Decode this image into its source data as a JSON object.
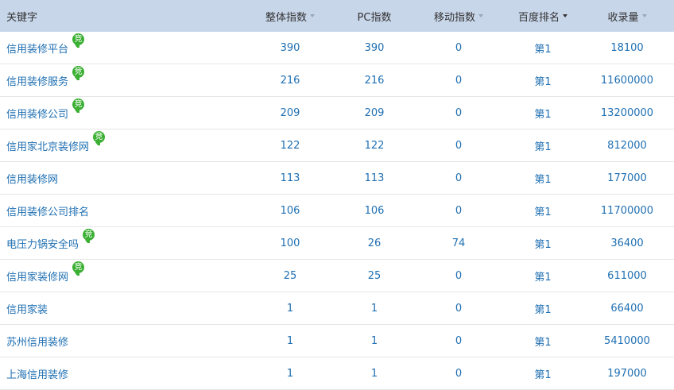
{
  "header": {
    "keyword": "关键字",
    "overall": "整体指数",
    "pc": "PC指数",
    "mobile": "移动指数",
    "rank": "百度排名",
    "indexed": "收录量"
  },
  "badge_text": "竞",
  "rows": [
    {
      "keyword": "信用装修平台",
      "overall": "390",
      "pc": "390",
      "mobile": "0",
      "rank": "第1",
      "indexed": "18100",
      "badge": true
    },
    {
      "keyword": "信用装修服务",
      "overall": "216",
      "pc": "216",
      "mobile": "0",
      "rank": "第1",
      "indexed": "11600000",
      "badge": true
    },
    {
      "keyword": "信用装修公司",
      "overall": "209",
      "pc": "209",
      "mobile": "0",
      "rank": "第1",
      "indexed": "13200000",
      "badge": true
    },
    {
      "keyword": "信用家北京装修网",
      "overall": "122",
      "pc": "122",
      "mobile": "0",
      "rank": "第1",
      "indexed": "812000",
      "badge": true
    },
    {
      "keyword": "信用装修网",
      "overall": "113",
      "pc": "113",
      "mobile": "0",
      "rank": "第1",
      "indexed": "177000",
      "badge": false
    },
    {
      "keyword": "信用装修公司排名",
      "overall": "106",
      "pc": "106",
      "mobile": "0",
      "rank": "第1",
      "indexed": "11700000",
      "badge": false
    },
    {
      "keyword": "电压力锅安全吗",
      "overall": "100",
      "pc": "26",
      "mobile": "74",
      "rank": "第1",
      "indexed": "36400",
      "badge": true
    },
    {
      "keyword": "信用家装修网",
      "overall": "25",
      "pc": "25",
      "mobile": "0",
      "rank": "第1",
      "indexed": "611000",
      "badge": true
    },
    {
      "keyword": "信用家装",
      "overall": "1",
      "pc": "1",
      "mobile": "0",
      "rank": "第1",
      "indexed": "66400",
      "badge": false
    },
    {
      "keyword": "苏州信用装修",
      "overall": "1",
      "pc": "1",
      "mobile": "0",
      "rank": "第1",
      "indexed": "5410000",
      "badge": false
    },
    {
      "keyword": "上海信用装修",
      "overall": "1",
      "pc": "1",
      "mobile": "0",
      "rank": "第1",
      "indexed": "197000",
      "badge": false
    }
  ],
  "colors": {
    "header_bg": "#c8d6ea",
    "link": "#1f6fb2",
    "badge": "#3cb034"
  }
}
